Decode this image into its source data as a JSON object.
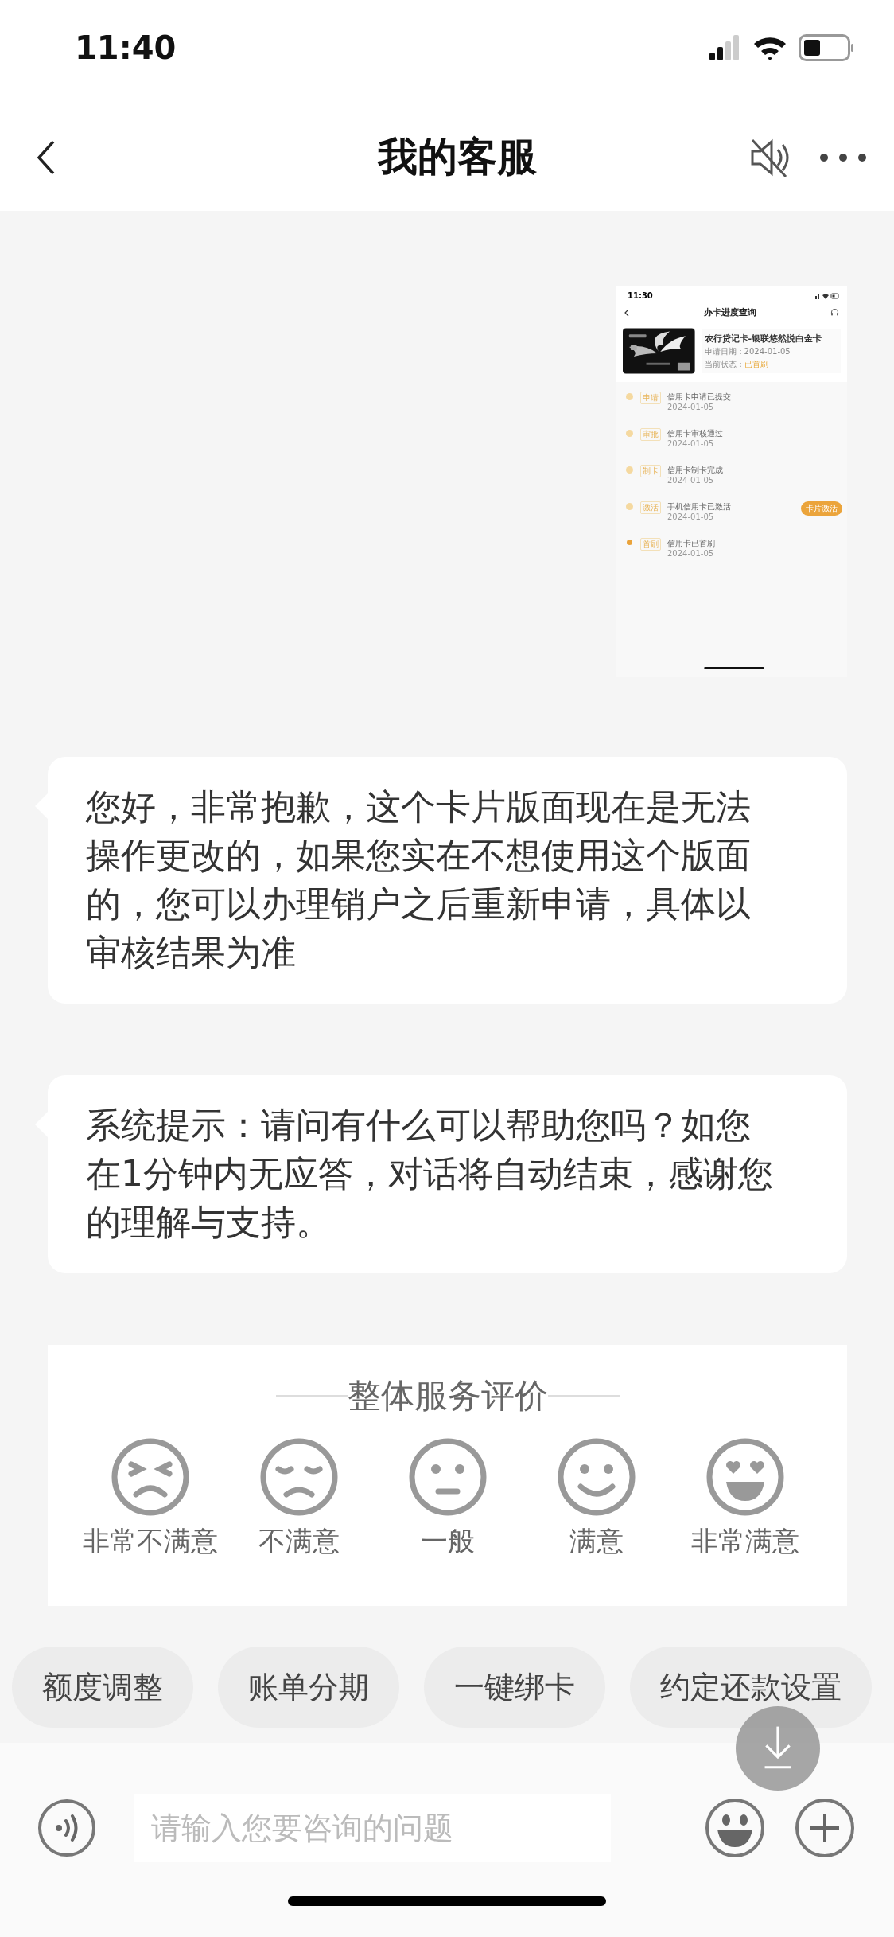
{
  "status_bar": {
    "time": "11:40"
  },
  "nav": {
    "title": "我的客服"
  },
  "messages": [
    {
      "screenshot": {
        "time": "11:30",
        "title": "办卡进度查询",
        "card": {
          "name": "农行贷记卡-银联悠然悦白金卡",
          "date": "申请日期：2024-01-05",
          "status_label": "当前状态：",
          "status_value": "已首刷"
        },
        "steps": [
          {
            "tag": "申请",
            "text": "信用卡申请已提交",
            "date": "2024-01-05",
            "current": false
          },
          {
            "tag": "审批",
            "text": "信用卡审核通过",
            "date": "2024-01-05",
            "current": false
          },
          {
            "tag": "制卡",
            "text": "信用卡制卡完成",
            "date": "2024-01-05",
            "current": false
          },
          {
            "tag": "激活",
            "text": "手机信用卡已激活",
            "date": "2024-01-05",
            "current": false,
            "action": "卡片激活"
          },
          {
            "tag": "首刷",
            "text": "信用卡已首刷",
            "date": "2024-01-05",
            "current": true
          }
        ]
      }
    },
    {
      "kind": "text",
      "text": "您好，非常抱歉，这个卡片版面现在是无法操作更改的，如果您实在不想使用这个版面的，您可以办理销户之后重新申请，具体以审核结果为准"
    },
    {
      "kind": "text",
      "text": "系统提示：请问有什么可以帮助您吗？如您在1分钟内无应答，对话将自动结束，感谢您的理解与支持。"
    },
    {
      "kind": "rating",
      "title": "整体服务评价",
      "options": [
        {
          "kind": "very_unhappy",
          "label": "非常不满意"
        },
        {
          "kind": "unhappy",
          "label": "不满意"
        },
        {
          "kind": "neutral",
          "label": "一般"
        },
        {
          "kind": "happy",
          "label": "满意"
        },
        {
          "kind": "very_happy",
          "label": "非常满意"
        }
      ]
    }
  ],
  "quick_replies": [
    "额度调整",
    "账单分期",
    "一键绑卡",
    "约定还款设置"
  ],
  "input": {
    "placeholder": "请输入您要咨询的问题"
  }
}
